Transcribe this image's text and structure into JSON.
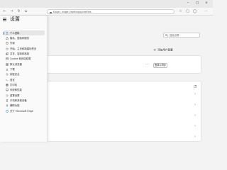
{
  "browser": {
    "address_host": "Edge",
    "address_url": "edge://settings/profiles"
  },
  "settings": {
    "title": "设置",
    "search_placeholder": "搜索设置",
    "add_profile_label": "添加用户配置",
    "more_label": "···",
    "sign_in_label": "登录以同步"
  },
  "sidebar": {
    "items": [
      {
        "label": "个人资料",
        "icon": "person-icon",
        "active": true
      },
      {
        "label": "隐私、搜索和服务",
        "icon": "lock-icon"
      },
      {
        "label": "外观",
        "icon": "appearance-icon"
      },
      {
        "label": "开始、主页和新建标签页",
        "icon": "power-icon"
      },
      {
        "label": "共享、复制和粘贴",
        "icon": "share-icon"
      },
      {
        "label": "Cookie 和网站权限",
        "icon": "site-permissions-icon"
      },
      {
        "label": "默认浏览器",
        "icon": "browser-icon"
      },
      {
        "label": "下载",
        "icon": "download-icon"
      },
      {
        "label": "家庭安全",
        "icon": "family-icon"
      },
      {
        "label": "语言",
        "icon": "language-icon"
      },
      {
        "label": "打印机",
        "icon": "printer-icon"
      },
      {
        "label": "系统和性能",
        "icon": "system-icon"
      },
      {
        "label": "重置设置",
        "icon": "reset-icon"
      },
      {
        "label": "手机和其他设备",
        "icon": "phone-icon"
      },
      {
        "label": "辅助功能",
        "icon": "accessibility-icon"
      },
      {
        "label": "关于 Microsoft Edge",
        "icon": "edge-icon"
      }
    ]
  }
}
